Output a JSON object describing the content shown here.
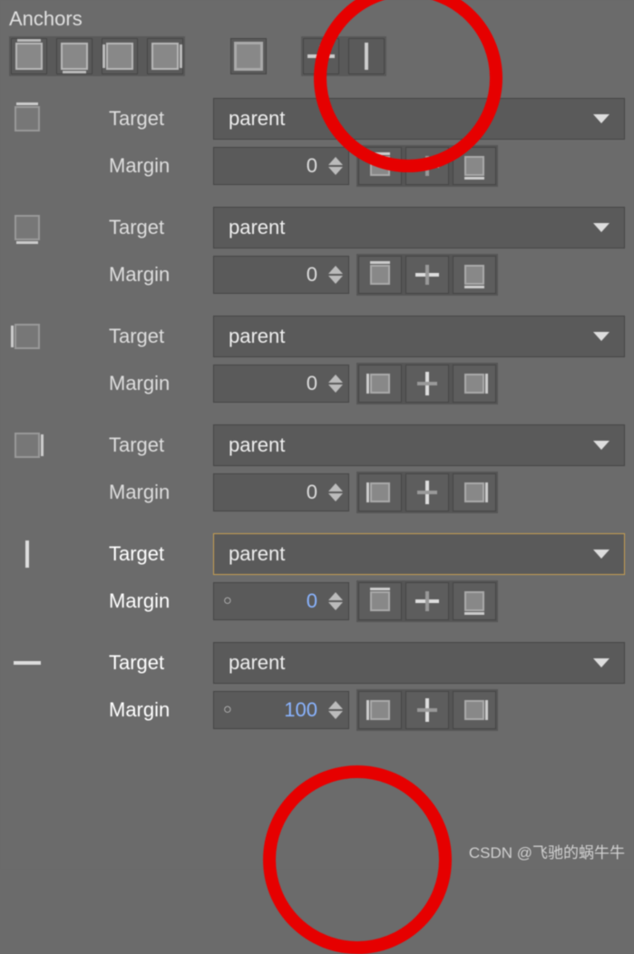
{
  "title": "Anchors",
  "watermark": "CSDN @飞驰的蜗牛牛",
  "anchors": [
    {
      "side": "top",
      "bold": false,
      "target": "parent",
      "margin": "0",
      "dot": false,
      "marginBlue": false,
      "hl": false,
      "btns": "h"
    },
    {
      "side": "bottom",
      "bold": false,
      "target": "parent",
      "margin": "0",
      "dot": false,
      "marginBlue": false,
      "hl": false,
      "btns": "h"
    },
    {
      "side": "left",
      "bold": false,
      "target": "parent",
      "margin": "0",
      "dot": false,
      "marginBlue": false,
      "hl": false,
      "btns": "v"
    },
    {
      "side": "right",
      "bold": false,
      "target": "parent",
      "margin": "0",
      "dot": false,
      "marginBlue": false,
      "hl": false,
      "btns": "v"
    },
    {
      "side": "vcenter",
      "bold": true,
      "target": "parent",
      "margin": "0",
      "dot": true,
      "marginBlue": true,
      "hl": true,
      "btns": "h"
    },
    {
      "side": "hcenter",
      "bold": true,
      "target": "parent",
      "margin": "100",
      "dot": true,
      "marginBlue": true,
      "hl": false,
      "btns": "v"
    }
  ],
  "labels": {
    "target": "Target",
    "margin": "Margin"
  }
}
